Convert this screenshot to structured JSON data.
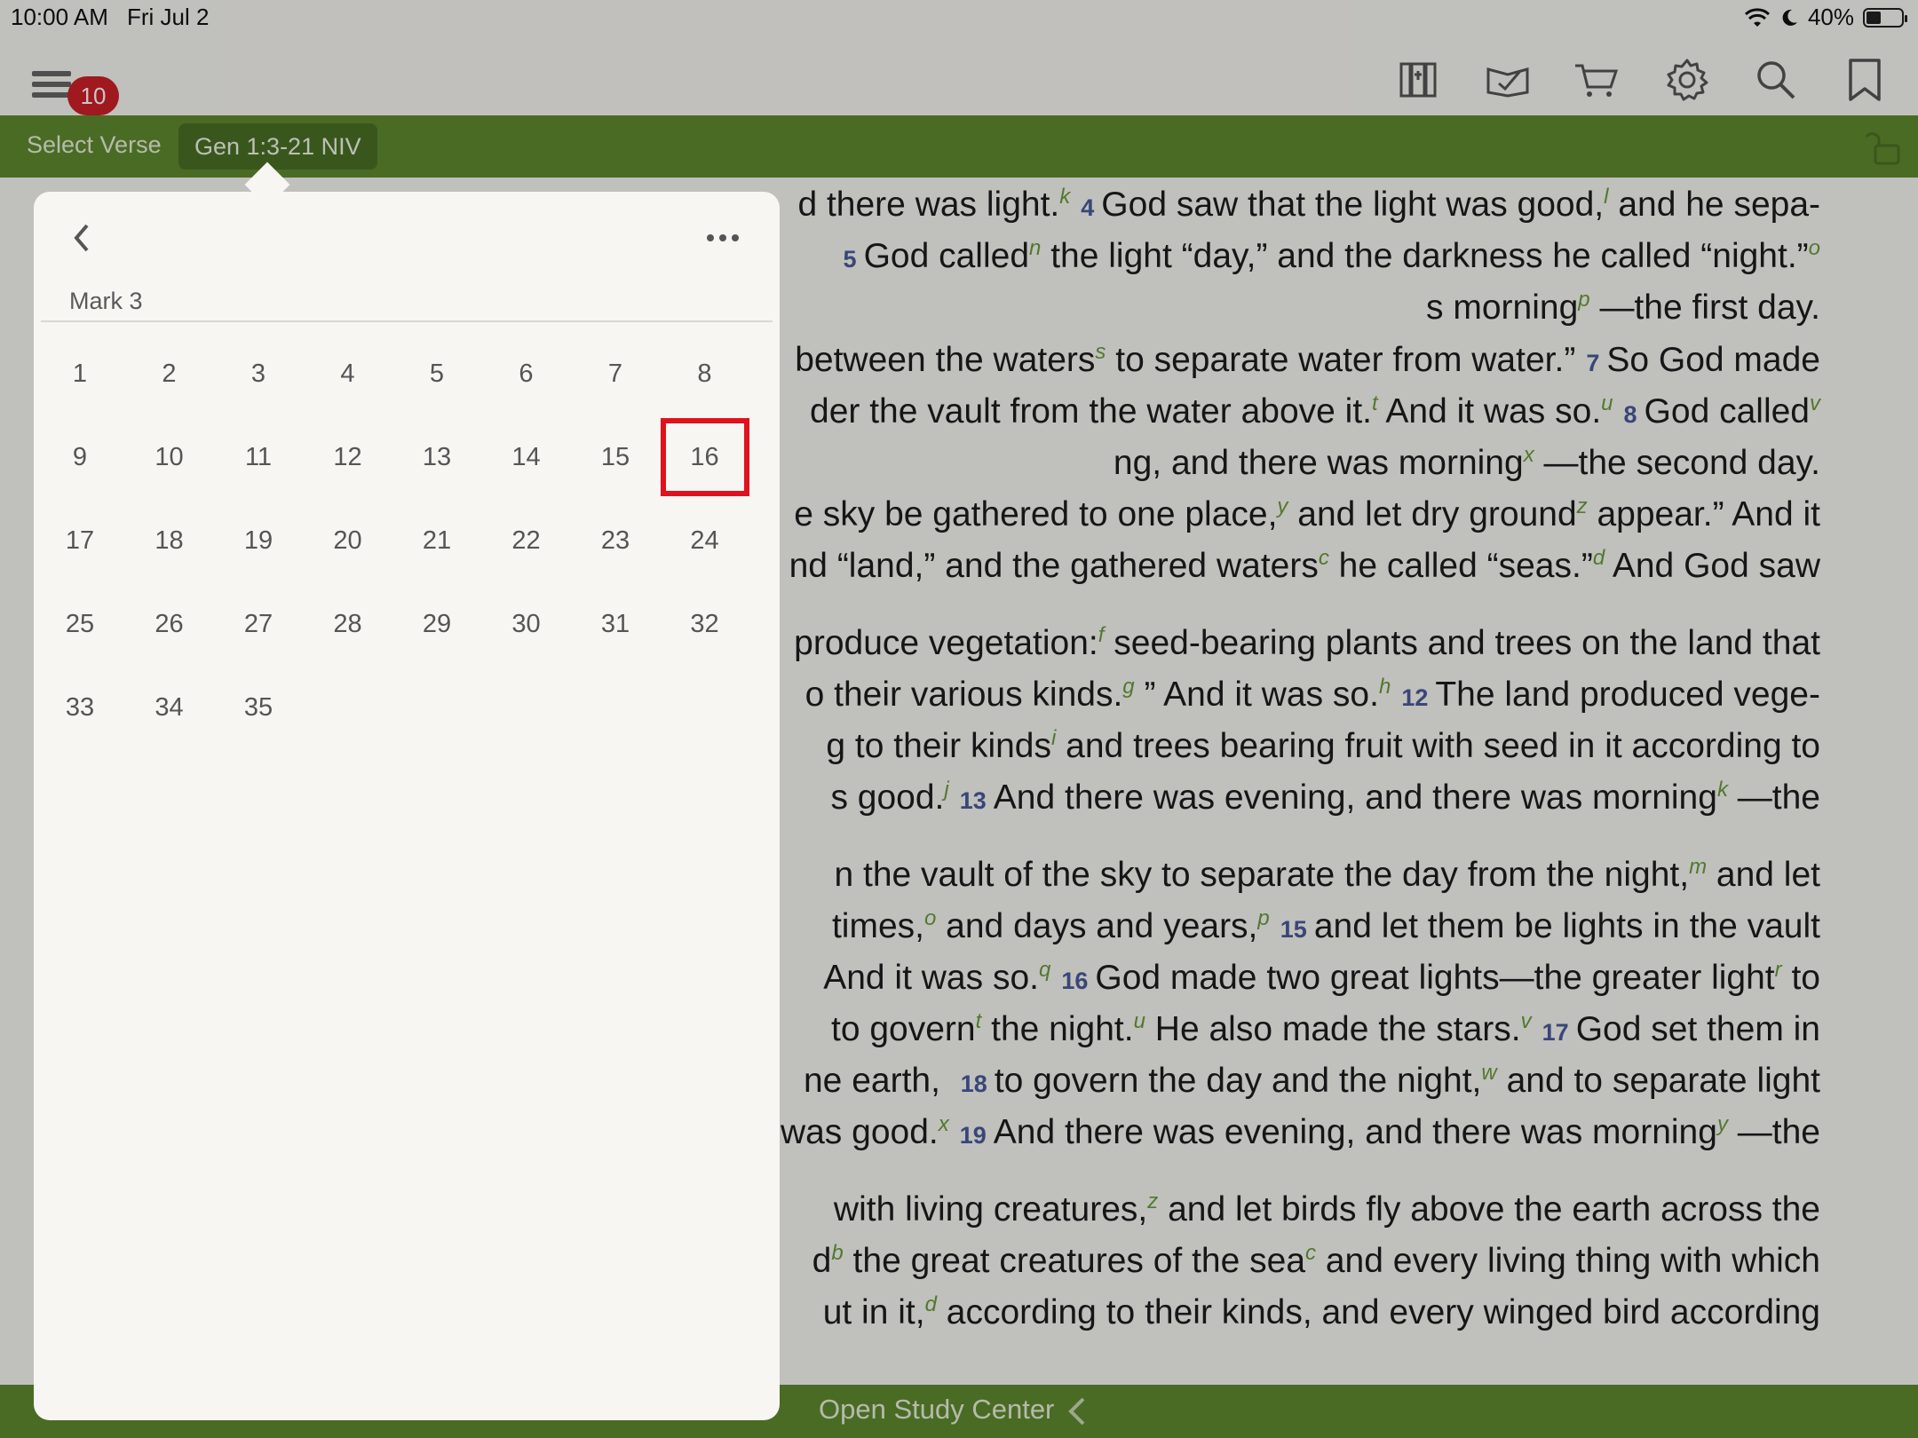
{
  "status_bar": {
    "time": "10:00 AM",
    "date": "Fri Jul 2",
    "battery": "40%"
  },
  "toolbar": {
    "notification_count": "10",
    "icons": [
      "library-icon",
      "reading-plan-icon",
      "cart-icon",
      "gear-icon",
      "search-icon",
      "bookmark-icon"
    ]
  },
  "verse_bar": {
    "select_label": "Select Verse",
    "reference": "Gen 1:3-21 NIV"
  },
  "popover": {
    "book": "Mark 3",
    "chapters": [
      "1",
      "2",
      "3",
      "4",
      "5",
      "6",
      "7",
      "8",
      "9",
      "10",
      "11",
      "12",
      "13",
      "14",
      "15",
      "16",
      "17",
      "18",
      "19",
      "20",
      "21",
      "22",
      "23",
      "24",
      "25",
      "26",
      "27",
      "28",
      "29",
      "30",
      "31",
      "32",
      "33",
      "34",
      "35"
    ],
    "highlighted": "16"
  },
  "bible_lines": [
    [
      {
        "t": "d there was light."
      },
      {
        "f": "k"
      },
      {
        "v": "4"
      },
      {
        "t": "God saw that the light was good,"
      },
      {
        "f": "l"
      },
      {
        "t": " and he sepa-"
      }
    ],
    [
      {
        "v": "5"
      },
      {
        "t": "God called"
      },
      {
        "f": "n"
      },
      {
        "t": " the light “day,” and the darkness he called “night.”"
      },
      {
        "f": "o"
      }
    ],
    [
      {
        "t": "s morning"
      },
      {
        "f": "p"
      },
      {
        "t": " —the first day."
      }
    ],
    [
      {
        "t": "between the waters"
      },
      {
        "f": "s"
      },
      {
        "t": " to separate water from water.”"
      },
      {
        "v": "7"
      },
      {
        "t": "So God made"
      }
    ],
    [
      {
        "t": "der the vault from the water above it."
      },
      {
        "f": "t"
      },
      {
        "t": " And it was so."
      },
      {
        "f": "u"
      },
      {
        "v": "8"
      },
      {
        "t": "God called"
      },
      {
        "f": "v"
      }
    ],
    [
      {
        "t": "ng, and there was morning"
      },
      {
        "f": "x"
      },
      {
        "t": " —the second day."
      }
    ],
    [
      {
        "t": "e sky be gathered to one place,"
      },
      {
        "f": "y"
      },
      {
        "t": " and let dry ground"
      },
      {
        "f": "z"
      },
      {
        "t": " appear.” And it"
      }
    ],
    [
      {
        "t": "nd “land,” and the gathered waters"
      },
      {
        "f": "c"
      },
      {
        "t": " he called “seas.”"
      },
      {
        "f": "d"
      },
      {
        "t": " And God saw"
      }
    ],
    [
      {
        "t": "produce vegetation:"
      },
      {
        "f": "f"
      },
      {
        "t": " seed-bearing plants and trees on the land that"
      }
    ],
    [
      {
        "t": "o their various kinds."
      },
      {
        "f": "g"
      },
      {
        "t": " ” And it was so."
      },
      {
        "f": "h"
      },
      {
        "v": "12"
      },
      {
        "t": "The land produced vege-"
      }
    ],
    [
      {
        "t": "g to their kinds"
      },
      {
        "f": "i"
      },
      {
        "t": " and trees bearing fruit with seed in it according to"
      }
    ],
    [
      {
        "t": "s good."
      },
      {
        "f": "j"
      },
      {
        "v": "13"
      },
      {
        "t": "And there was evening, and there was morning"
      },
      {
        "f": "k"
      },
      {
        "t": " —the"
      }
    ],
    [
      {
        "t": "n the vault of the sky to separate the day from the night,"
      },
      {
        "f": "m"
      },
      {
        "t": " and let"
      }
    ],
    [
      {
        "t": "times,"
      },
      {
        "f": "o"
      },
      {
        "t": " and days and years,"
      },
      {
        "f": "p"
      },
      {
        "v": "15"
      },
      {
        "t": "and let them be lights in the vault"
      }
    ],
    [
      {
        "t": "And it was so."
      },
      {
        "f": "q"
      },
      {
        "v": "16"
      },
      {
        "t": "God made two great lights—the greater light"
      },
      {
        "f": "r"
      },
      {
        "t": " to"
      }
    ],
    [
      {
        "t": "to govern"
      },
      {
        "f": "t"
      },
      {
        "t": " the night."
      },
      {
        "f": "u"
      },
      {
        "t": " He also made the stars."
      },
      {
        "f": "v"
      },
      {
        "v": "17"
      },
      {
        "t": "God set them in"
      }
    ],
    [
      {
        "t": "ne earth, "
      },
      {
        "v": "18"
      },
      {
        "t": "to govern the day and the night,"
      },
      {
        "f": "w"
      },
      {
        "t": " and to separate light"
      }
    ],
    [
      {
        "t": "was good."
      },
      {
        "f": "x"
      },
      {
        "v": "19"
      },
      {
        "t": "And there was evening, and there was morning"
      },
      {
        "f": "y"
      },
      {
        "t": " —the"
      }
    ],
    [
      {
        "t": "with living creatures,"
      },
      {
        "f": "z"
      },
      {
        "t": " and let birds fly above the earth across the"
      }
    ],
    [
      {
        "t": "d"
      },
      {
        "f": "b"
      },
      {
        "t": " the great creatures of the sea"
      },
      {
        "f": "c"
      },
      {
        "t": " and every living thing with which"
      }
    ],
    [
      {
        "t": "ut in it,"
      },
      {
        "f": "d"
      },
      {
        "t": " according to their kinds, and every winged bird according"
      }
    ]
  ],
  "bottom_bar": {
    "label": "Open Study Center"
  },
  "colors": {
    "accent_green": "#5f8a2f",
    "verse_number": "#4a5a9a",
    "footnote": "#6a9a3a",
    "highlight": "#e0121e",
    "badge": "#cc2128"
  }
}
